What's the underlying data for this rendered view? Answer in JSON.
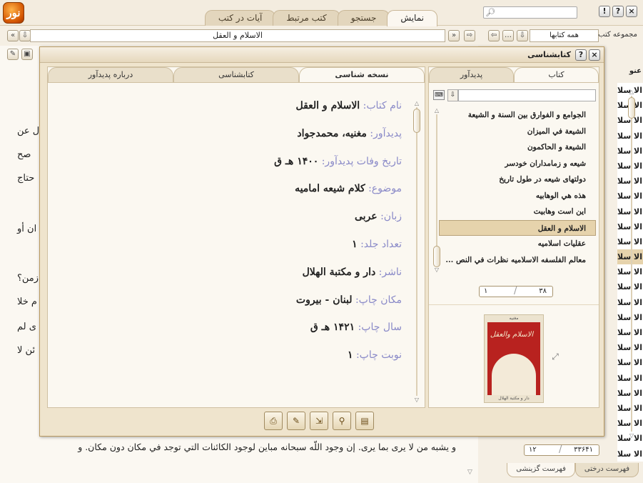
{
  "app": {
    "logo": "نور"
  },
  "top_tabs": [
    "نمایش",
    "جستجو",
    "کتب مرتبط",
    "آیات در کتب"
  ],
  "window_buttons": [
    "×",
    "?",
    "!"
  ],
  "address": {
    "value": "الاسلام و العقل"
  },
  "collection": {
    "label": "مجموعه کتب",
    "value": "همه کتابها"
  },
  "reader": {
    "fragments": [
      "ل عن",
      "صح",
      "حتاج",
      "ان أو",
      "زمن؟",
      "م خلا",
      "ى لم",
      "ئن لا"
    ],
    "bottom_line": "و يشبه من لا يرى بما يرى. إن وجود اللّه سبحانه مباين لوجود الكائنات التي توجد في مكان دون مكان. و"
  },
  "right_panel": {
    "header": "عنو",
    "items": [
      "الا سلا",
      "الا سلا",
      "الا سلا",
      "الا سلا",
      "الا سلا",
      "الا سلا",
      "الا سلا",
      "الا سلا",
      "الا سلا",
      "الا سلا",
      "الا سلا",
      "الا سلا",
      "الا سلا",
      "الا سلا",
      "الا سلا",
      "الا سلا",
      "الا سلا",
      "الا سلا",
      "الا سلا",
      "الا سلا",
      "الا سلا",
      "الا سلا",
      "الا سلا",
      "الا سلا",
      "الا سلا"
    ],
    "pager": {
      "current": "۱۲",
      "total": "۳۳۶۴۱"
    },
    "bottom_tabs": [
      "فهرست درختی",
      "فهرست گزینشی"
    ]
  },
  "dialog": {
    "title": "کتابشناسی",
    "right_tabs": [
      "کتاب",
      "پدیدآور"
    ],
    "books": [
      "الجوامع و الفوارق بين السنة و الشيعة",
      "الشيعة في الميزان",
      "الشيعة و الحاكمون",
      "شیعه و زمامداران خودسر",
      "دولتهای شیعه در طول تاریخ",
      "هذه هي الوهابيه",
      "این است وهابیت",
      "الاسلام و العقل",
      "عقليات اسلاميه",
      "معالم الفلسفه الاسلاميه نظرات في النص ..."
    ],
    "selected_book_index": 7,
    "pager": {
      "current": "۳۸",
      "total": "۱"
    },
    "cover": {
      "title": "الاسلام والعقل",
      "top": "مغنیه",
      "bottom": "دار و مکتبة الهلال"
    },
    "left_tabs": [
      "نسخه شناسی",
      "کتابشناسی",
      "درباره پدیدآور"
    ],
    "fields": [
      {
        "label": "نام کتاب:",
        "value": "الاسلام و العقل"
      },
      {
        "label": "پدیدآور:",
        "value": "مغنیه، محمدجواد"
      },
      {
        "label": "تاریخ وفات پدیدآور:",
        "value": "۱۴۰۰ هـ ق"
      },
      {
        "label": "موضوع:",
        "value": "کلام شیعه امامیه"
      },
      {
        "label": "زبان:",
        "value": "عربی"
      },
      {
        "label": "تعداد جلد:",
        "value": "۱"
      },
      {
        "label": "ناشر:",
        "value": "دار و مکتبة الهلال"
      },
      {
        "label": "مکان چاپ:",
        "value": "لبنان - بیروت"
      },
      {
        "label": "سال چاپ:",
        "value": "۱۴۲۱ هـ ق"
      },
      {
        "label": "نوبت چاپ:",
        "value": "۱"
      }
    ],
    "tools": [
      "print-icon",
      "edit-icon",
      "export-icon",
      "search-icon",
      "page-icon"
    ]
  },
  "colors": {
    "label": "#8a8ac8",
    "accent": "#d35400",
    "selection": "#e6d3ac"
  }
}
